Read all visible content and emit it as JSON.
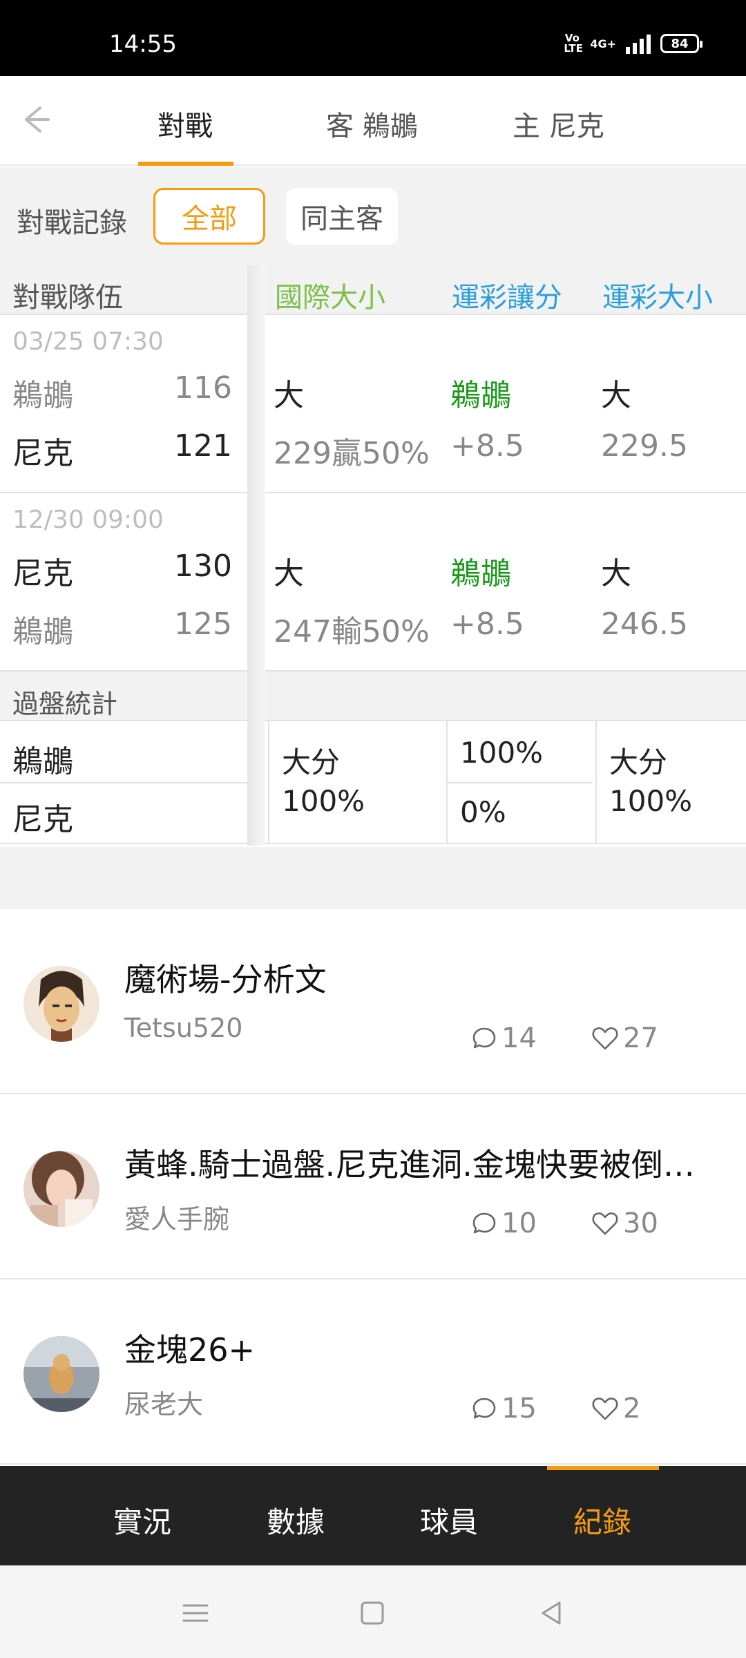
{
  "status_bar": {
    "time": "14:55",
    "volte": "Vo LTE",
    "network": "4G+",
    "battery": "84"
  },
  "header": {
    "tabs": [
      {
        "label": "對戰",
        "active": true
      },
      {
        "label": "客 鵜鶘",
        "active": false
      },
      {
        "label": "主 尼克",
        "active": false
      }
    ]
  },
  "filter": {
    "label": "對戰記錄",
    "options": [
      "全部",
      "同主客"
    ],
    "selected": "全部"
  },
  "table": {
    "headers": [
      "對戰隊伍",
      "國際大小",
      "運彩讓分",
      "運彩大小"
    ],
    "matches": [
      {
        "date": "03/25 07:30",
        "team1": "鵜鶘",
        "score1": "116",
        "team2": "尼克",
        "score2": "121",
        "intl_top": "大",
        "intl_bottom": "229贏50%",
        "spread_top": "鵜鶘",
        "spread_bottom": "+8.5",
        "total_top": "大",
        "total_bottom": "229.5"
      },
      {
        "date": "12/30 09:00",
        "team1": "尼克",
        "score1": "130",
        "team2": "鵜鶘",
        "score2": "125",
        "intl_top": "大",
        "intl_bottom": "247輸50%",
        "spread_top": "鵜鶘",
        "spread_bottom": "+8.5",
        "total_top": "大",
        "total_bottom": "246.5"
      }
    ],
    "stats": {
      "title": "過盤統計",
      "team1": "鵜鶘",
      "team2": "尼克",
      "intl_label": "大分",
      "intl_value": "100%",
      "spread_team1": "100%",
      "spread_team2": "0%",
      "total_label": "大分",
      "total_value": "100%"
    }
  },
  "articles": [
    {
      "title": "魔術場-分析文",
      "author": "Tetsu520",
      "comments": "14",
      "likes": "27"
    },
    {
      "title": "黃蜂.騎士過盤.尼克進洞.金塊快要被倒…",
      "author": "愛人手腕",
      "comments": "10",
      "likes": "30"
    },
    {
      "title": "金塊26+",
      "author": "尿老大",
      "comments": "15",
      "likes": "2"
    }
  ],
  "bottom_nav": {
    "items": [
      "實況",
      "數據",
      "球員",
      "紀錄"
    ],
    "active": "紀錄"
  },
  "colors": {
    "accent": "#f39c12",
    "intl_header": "#7cc04a",
    "lottery_header": "#2b9fd9",
    "team_green": "#1a9a1a"
  }
}
